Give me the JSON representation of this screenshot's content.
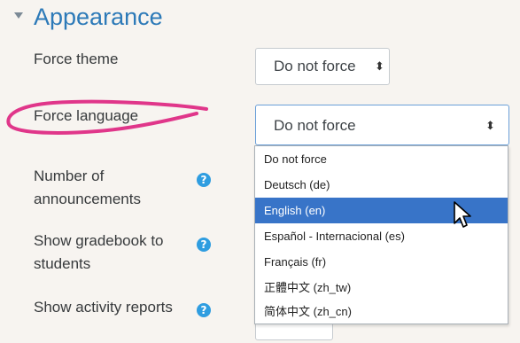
{
  "section": {
    "title": "Appearance"
  },
  "fields": {
    "force_theme": {
      "label": "Force theme",
      "value": "Do not force"
    },
    "force_language": {
      "label": "Force language",
      "value": "Do not force"
    },
    "number_of_announcements": {
      "label_line1": "Number of",
      "label_line2": "announcements"
    },
    "show_gradebook": {
      "label_line1": "Show gradebook to",
      "label_line2": "students"
    },
    "show_activity_reports": {
      "label": "Show activity reports"
    }
  },
  "language_options": [
    {
      "label": "Do not force"
    },
    {
      "label": "Deutsch (de)"
    },
    {
      "label": "English (en)"
    },
    {
      "label": "Español - Internacional (es)"
    },
    {
      "label": "Français (fr)"
    },
    {
      "label": "正體中文 (zh_tw)"
    },
    {
      "label": "简体中文 (zh_cn)"
    }
  ],
  "highlighted_option_index": 2,
  "icons": {
    "section_toggle": "caret-down-icon",
    "select_arrow": "sort-arrows-icon",
    "help": "question-circle-icon",
    "cursor": "mouse-pointer-icon",
    "annotation": "pink-ellipse-annotation"
  },
  "colors": {
    "accent": "#2d7ab8",
    "help_icon": "#2f9de0",
    "highlight": "#3874c8",
    "annotation": "#e0368a"
  }
}
